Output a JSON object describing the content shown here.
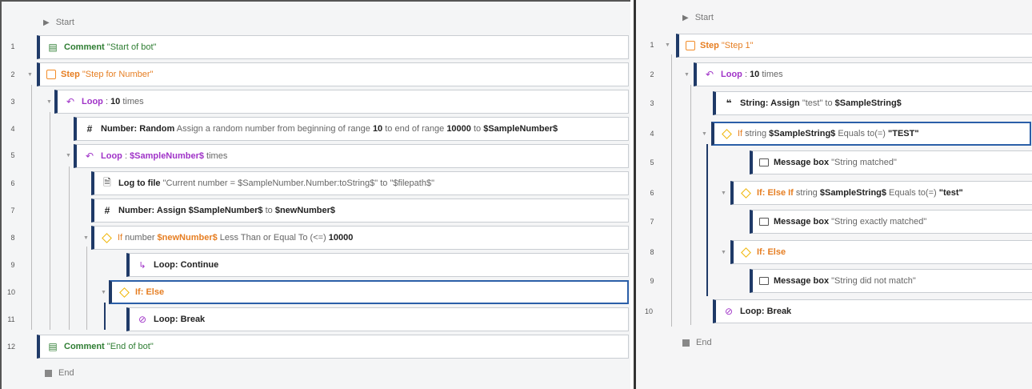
{
  "colors": {
    "accent": "#1f3a68",
    "comment_green": "#2e7d32",
    "step_orange": "#f28c28",
    "loop_purple": "#a033c8",
    "if_yellow": "#f0b400",
    "selection_blue": "#2b5fa8"
  },
  "left": {
    "start_label": "Start",
    "end_label": "End",
    "lines": [
      {
        "num": "1",
        "icon": "comment-icon",
        "parts": [
          "Comment",
          " \"Start of bot\""
        ]
      },
      {
        "num": "2",
        "icon": "step-icon",
        "parts": [
          "Step",
          " \"Step for Number\""
        ]
      },
      {
        "num": "3",
        "icon": "loop-icon",
        "parts": [
          "Loop",
          " : ",
          "10",
          " times"
        ]
      },
      {
        "num": "4",
        "icon": "hash-icon",
        "parts": [
          "Number: Random",
          " Assign a random number from beginning of range ",
          "10",
          " to end of range ",
          "10000",
          " to ",
          "$SampleNumber$"
        ]
      },
      {
        "num": "5",
        "icon": "loop-icon",
        "parts": [
          "Loop",
          " : ",
          "$SampleNumber$",
          " times"
        ]
      },
      {
        "num": "6",
        "icon": "log-file-icon",
        "parts": [
          "Log to file",
          " \"Current number = $SampleNumber.Number:toString$\" to \"$filepath$\""
        ]
      },
      {
        "num": "7",
        "icon": "hash-icon",
        "parts": [
          "Number: Assign",
          " ",
          "$SampleNumber$",
          " to ",
          "$newNumber$"
        ]
      },
      {
        "num": "8",
        "icon": "if-icon",
        "parts": [
          "If",
          " number ",
          "$newNumber$",
          " Less Than or Equal To (<=) ",
          "10000"
        ]
      },
      {
        "num": "9",
        "icon": "loop-continue-icon",
        "parts": [
          "Loop: Continue"
        ]
      },
      {
        "num": "10",
        "icon": "if-icon",
        "parts": [
          "If: Else"
        ]
      },
      {
        "num": "11",
        "icon": "loop-break-icon",
        "parts": [
          "Loop: Break"
        ]
      },
      {
        "num": "12",
        "icon": "comment-icon",
        "parts": [
          "Comment",
          " \"End of bot\""
        ]
      }
    ]
  },
  "right": {
    "start_label": "Start",
    "end_label": "End",
    "lines": [
      {
        "num": "1",
        "icon": "step-icon",
        "parts": [
          "Step",
          " \"Step 1\""
        ]
      },
      {
        "num": "2",
        "icon": "loop-icon",
        "parts": [
          "Loop",
          " : ",
          "10",
          " times"
        ]
      },
      {
        "num": "3",
        "icon": "quote-icon",
        "parts": [
          "String: Assign",
          " \"test\" to ",
          "$SampleString$"
        ]
      },
      {
        "num": "4",
        "icon": "if-icon",
        "parts": [
          "If",
          " string ",
          "$SampleString$",
          " Equals to(=) ",
          "\"TEST\""
        ]
      },
      {
        "num": "5",
        "icon": "message-box-icon",
        "parts": [
          "Message box",
          " \"String matched\""
        ]
      },
      {
        "num": "6",
        "icon": "if-icon",
        "parts": [
          "If: Else If",
          " string ",
          "$SampleString$",
          " Equals to(=) ",
          "\"test\""
        ]
      },
      {
        "num": "7",
        "icon": "message-box-icon",
        "parts": [
          "Message box",
          " \"String exactly matched\""
        ]
      },
      {
        "num": "8",
        "icon": "if-icon",
        "parts": [
          "If: Else"
        ]
      },
      {
        "num": "9",
        "icon": "message-box-icon",
        "parts": [
          "Message box",
          " \"String did not match\""
        ]
      },
      {
        "num": "10",
        "icon": "loop-break-icon",
        "parts": [
          "Loop: Break"
        ]
      }
    ]
  }
}
